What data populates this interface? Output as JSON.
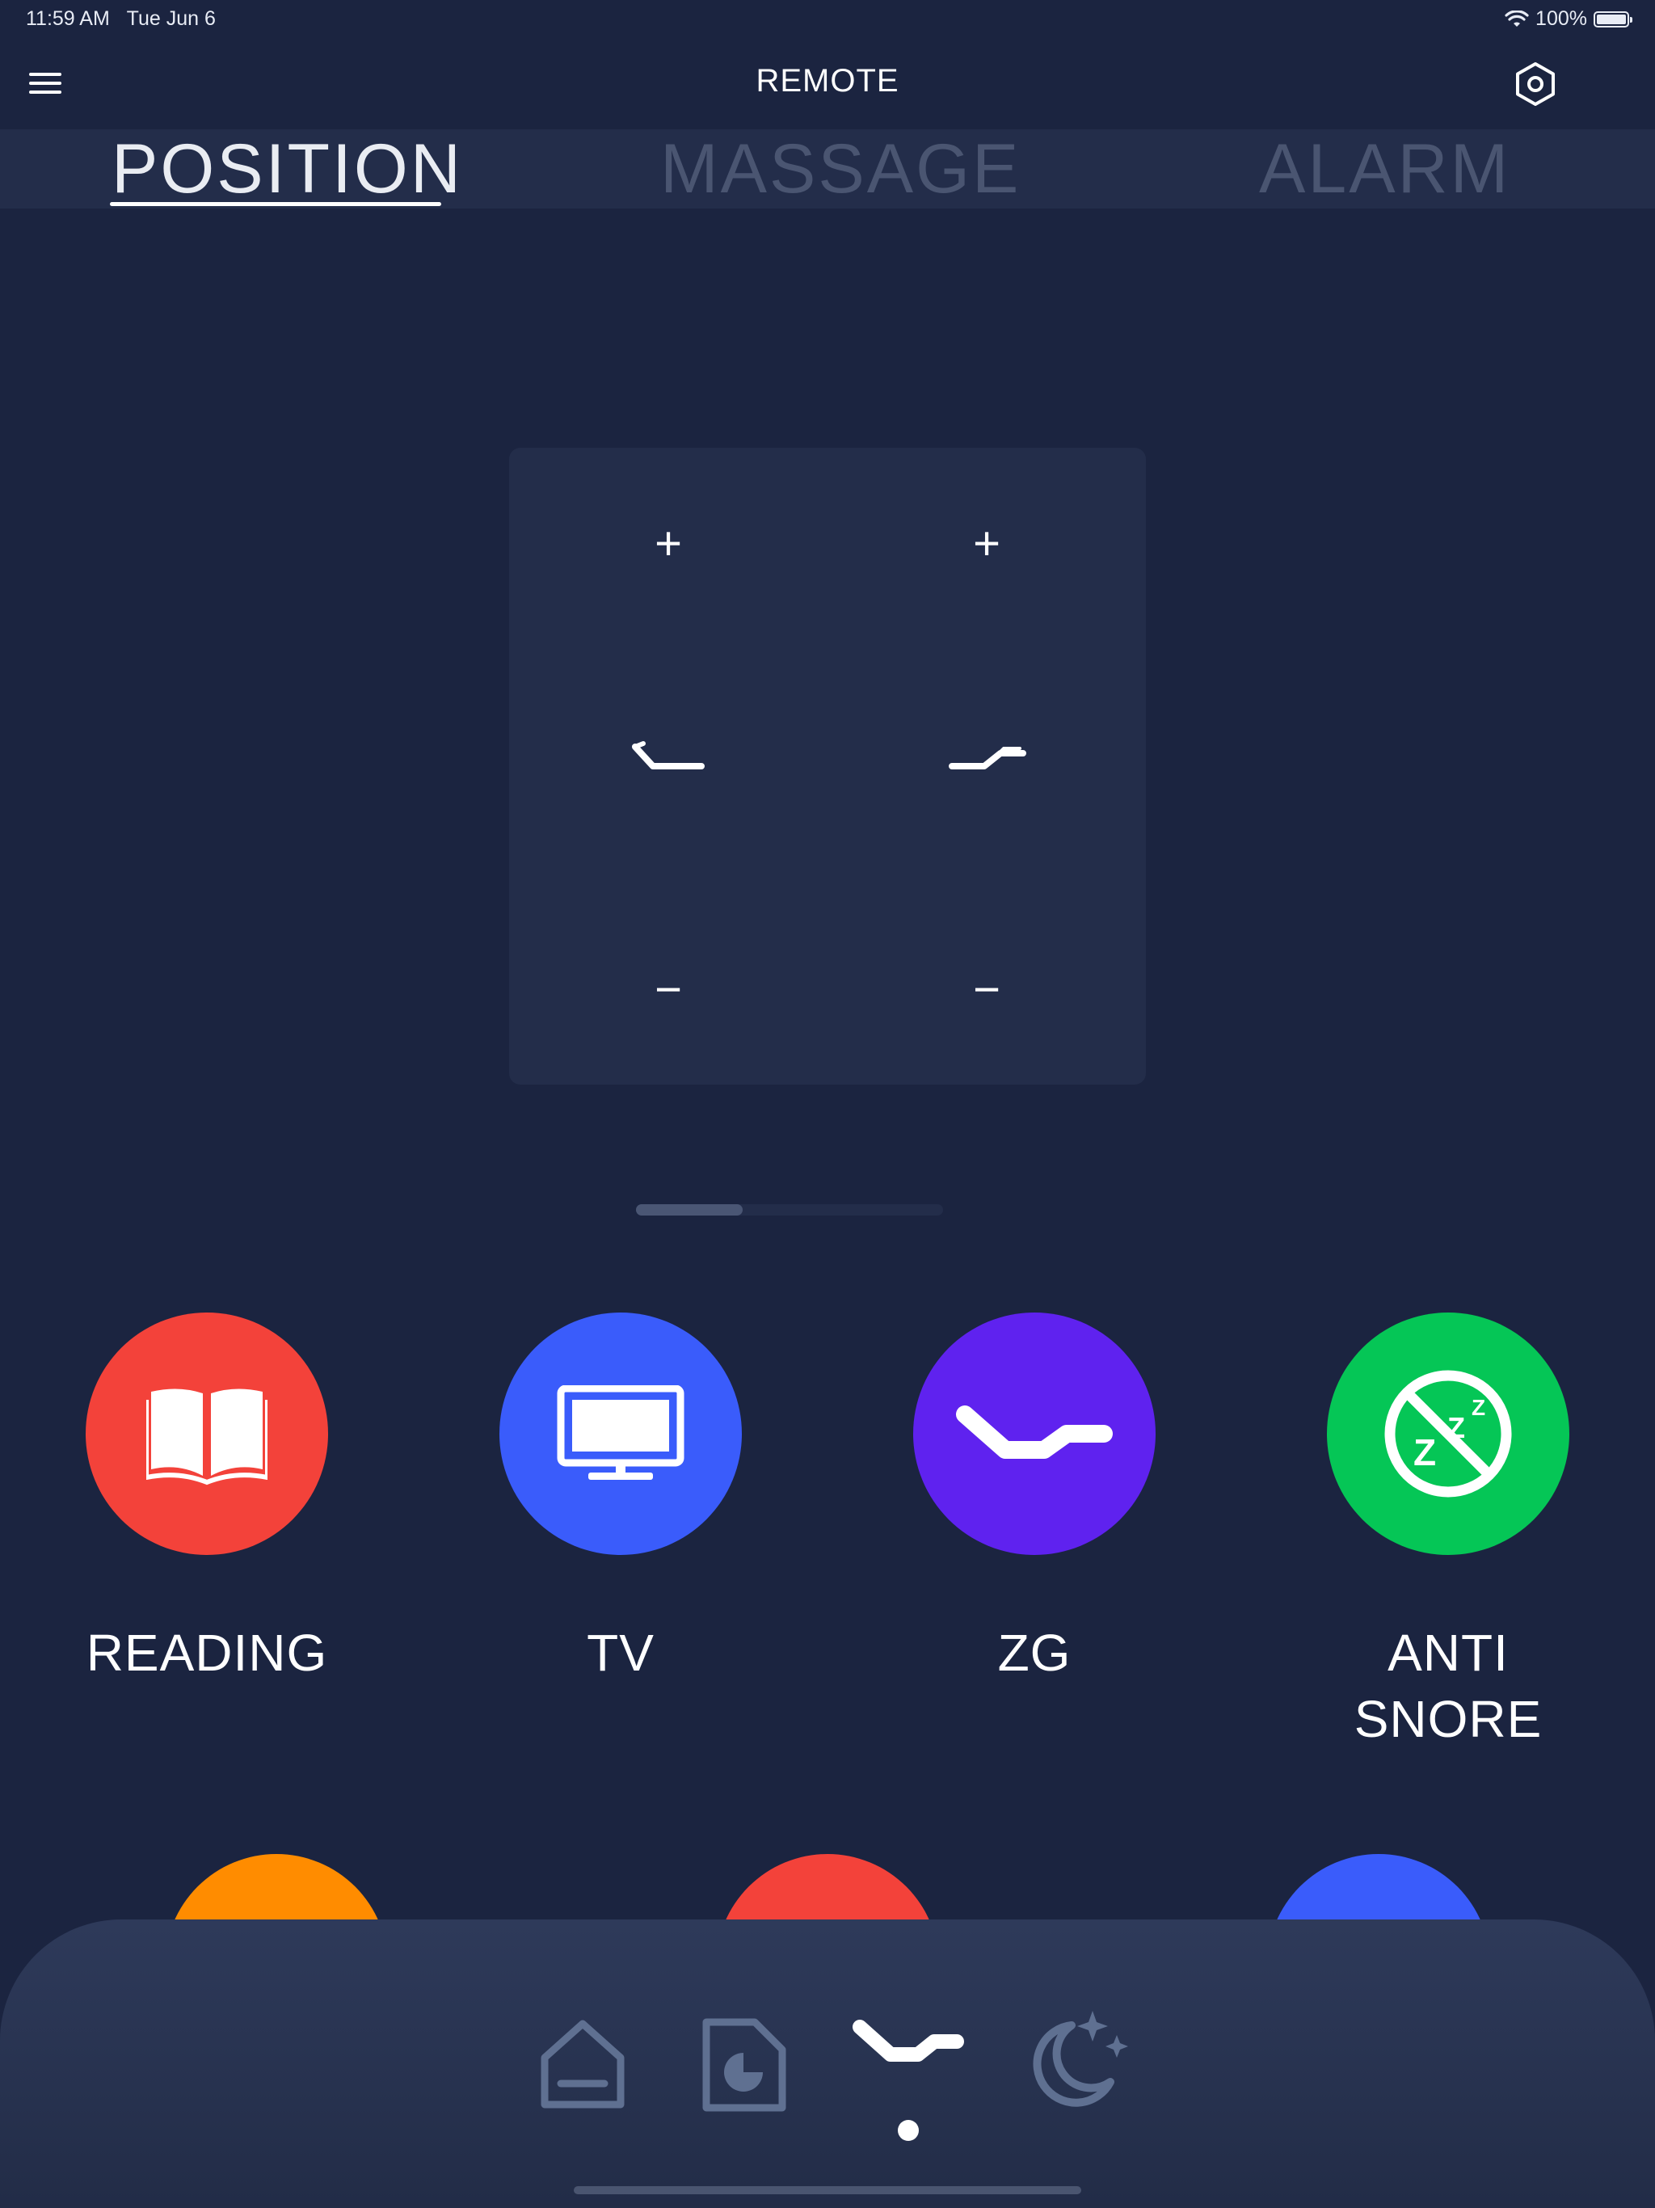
{
  "status_bar": {
    "time": "11:59 AM",
    "date": "Tue Jun 6",
    "battery": "100%"
  },
  "header": {
    "title": "REMOTE",
    "menu_icon": "hamburger-menu-icon",
    "settings_icon": "hexagon-settings-icon"
  },
  "tabs": [
    {
      "label": "POSITION",
      "active": true
    },
    {
      "label": "MASSAGE",
      "active": false
    },
    {
      "label": "ALARM",
      "active": false
    }
  ],
  "position_panel": {
    "head": {
      "plus": "+",
      "minus": "−",
      "icon": "head-raise-icon"
    },
    "foot": {
      "plus": "+",
      "minus": "−",
      "icon": "foot-raise-icon"
    }
  },
  "presets": [
    {
      "label": "READING",
      "color": "#f3423a",
      "icon": "open-book-icon"
    },
    {
      "label": "TV",
      "color": "#3a5cfb",
      "icon": "tv-monitor-icon"
    },
    {
      "label": "ZG",
      "color": "#5f22ef",
      "icon": "zero-gravity-icon"
    },
    {
      "label": "ANTI\nSNORE",
      "color": "#05c656",
      "icon": "no-snore-icon"
    }
  ],
  "more_presets_colors": [
    "#ff8c00",
    "#f3423a",
    "#3a5cfb"
  ],
  "bottom_nav": [
    {
      "name": "home",
      "icon": "home-icon",
      "active": false
    },
    {
      "name": "report",
      "icon": "report-chart-icon",
      "active": false
    },
    {
      "name": "remote",
      "icon": "bed-remote-icon",
      "active": true
    },
    {
      "name": "sleep",
      "icon": "moon-stars-icon",
      "active": false
    }
  ],
  "colors": {
    "background": "#1b2440",
    "panel": "#232d4a",
    "inactive_icon": "#5f7091"
  }
}
